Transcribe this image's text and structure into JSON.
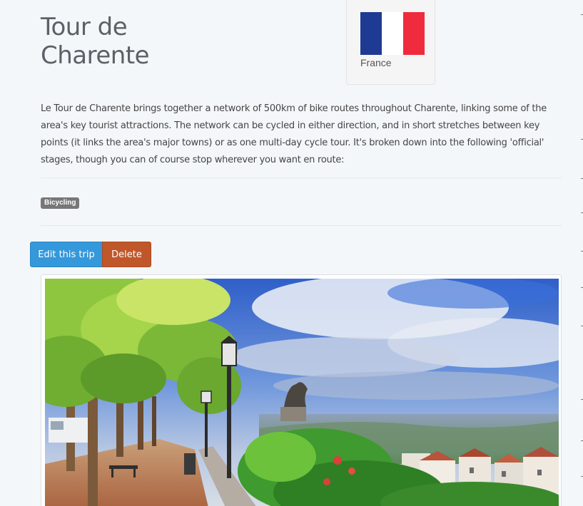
{
  "trip": {
    "title": "Tour de Charente",
    "country": "France",
    "description": "Le Tour de Charente brings together a network of 500km of bike routes throughout Charente, linking some of the area's key tourist attractions. The network can be cycled in either direction, and in short stretches between key points (it links the area's major towns) or as one multi-day cycle tour. It's broken down into the following 'official' stages, though you can of course stop wherever you want en route:",
    "tags": [
      "Bicycling"
    ]
  },
  "flag": {
    "colors": [
      "#1f3a93",
      "#ffffff",
      "#ef2b3d"
    ]
  },
  "actions": {
    "edit_label": "Edit this trip",
    "delete_label": "Delete"
  },
  "colors": {
    "edit_button": "#3498db",
    "delete_button": "#c0572a",
    "tag": "#777777"
  }
}
